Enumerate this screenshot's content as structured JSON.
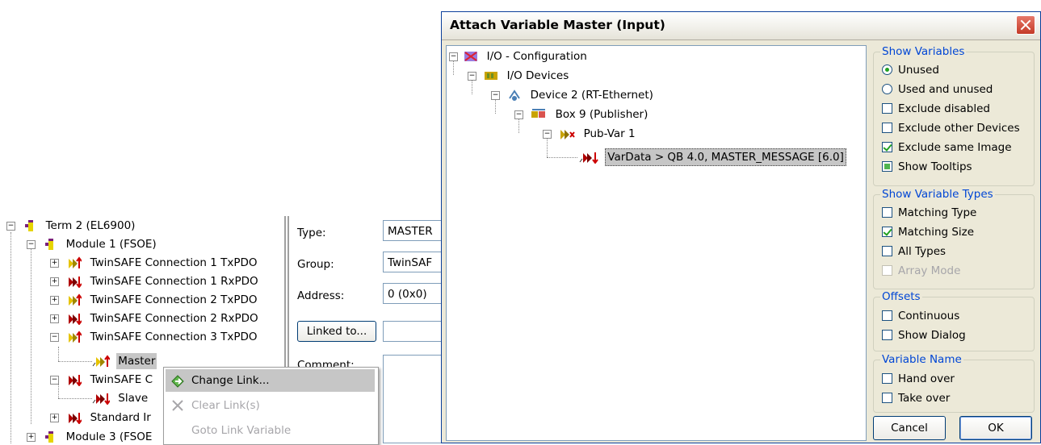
{
  "left_tree": {
    "items": [
      {
        "label": "Term 2 (EL6900)"
      },
      {
        "label": "Module 1 (FSOE)"
      },
      {
        "label": "TwinSAFE Connection 1 TxPDO"
      },
      {
        "label": "TwinSAFE Connection 1 RxPDO"
      },
      {
        "label": "TwinSAFE Connection 2 TxPDO"
      },
      {
        "label": "TwinSAFE Connection 2 RxPDO"
      },
      {
        "label": "TwinSAFE Connection 3 TxPDO"
      },
      {
        "label": "Master"
      },
      {
        "label": "TwinSAFE C"
      },
      {
        "label": "Slave"
      },
      {
        "label": "Standard Ir"
      },
      {
        "label": "Module 3 (FSOE"
      }
    ]
  },
  "properties": {
    "type_label": "Type:",
    "type_value": "MASTER",
    "group_label": "Group:",
    "group_value": "TwinSAF",
    "address_label": "Address:",
    "address_value": "0 (0x0)",
    "linked_to_button": "Linked to...",
    "comment_label": "Comment:"
  },
  "context_menu": {
    "items": [
      {
        "label": "Change Link...",
        "enabled": true
      },
      {
        "label": "Clear Link(s)",
        "enabled": false
      },
      {
        "label": "Goto Link Variable",
        "enabled": false
      }
    ]
  },
  "dialog": {
    "title": "Attach Variable Master (Input)",
    "tree": [
      {
        "label": "I/O - Configuration"
      },
      {
        "label": "I/O Devices"
      },
      {
        "label": "Device 2 (RT-Ethernet)"
      },
      {
        "label": "Box 9 (Publisher)"
      },
      {
        "label": "Pub-Var 1"
      },
      {
        "label": "VarData > QB 4.0, MASTER_MESSAGE [6.0]"
      }
    ],
    "show_variables": {
      "title": "Show Variables",
      "unused": "Unused",
      "used_and_unused": "Used and unused",
      "exclude_disabled": "Exclude disabled",
      "exclude_other_devices": "Exclude other Devices",
      "exclude_same_image": "Exclude same Image",
      "show_tooltips": "Show Tooltips"
    },
    "show_variable_types": {
      "title": "Show Variable Types",
      "matching_type": "Matching Type",
      "matching_size": "Matching Size",
      "all_types": "All Types",
      "array_mode": "Array Mode"
    },
    "offsets": {
      "title": "Offsets",
      "continuous": "Continuous",
      "show_dialog": "Show Dialog"
    },
    "variable_name": {
      "title": "Variable Name",
      "hand_over": "Hand over",
      "take_over": "Take over"
    },
    "cancel_button": "Cancel",
    "ok_button": "OK"
  },
  "colors": {
    "group_title": "#0046d5",
    "dialog_bg": "#ece9d8",
    "check_green": "#21a121"
  }
}
